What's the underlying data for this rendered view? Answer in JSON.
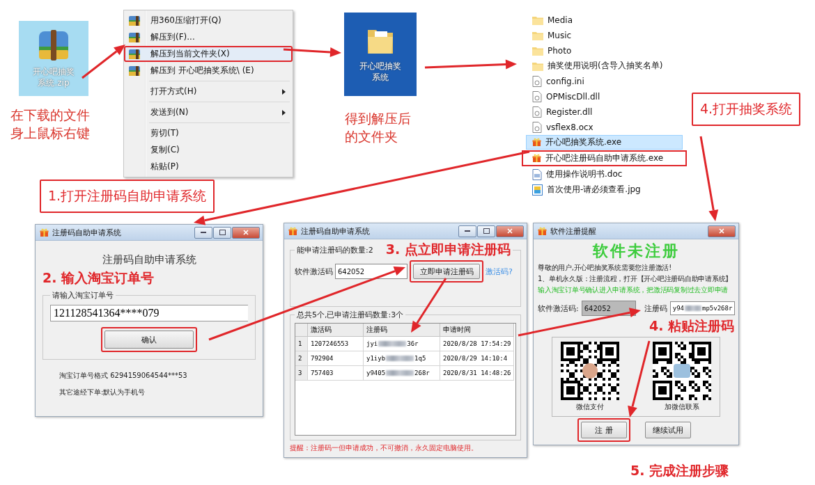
{
  "zip_file": {
    "label_lines": [
      "开心吧抽奖",
      "系统.zip"
    ]
  },
  "zip_caption": [
    "在下载的文件",
    "身上鼠标右键"
  ],
  "context_menu": {
    "items": [
      {
        "kind": "archive",
        "label": "用360压缩打开(Q)",
        "highlighted": false
      },
      {
        "kind": "archive",
        "label": "解压到(F)...",
        "highlighted": false
      },
      {
        "kind": "archive",
        "label": "解压到当前文件夹(X)",
        "highlighted": true
      },
      {
        "kind": "archive",
        "label": "解压到 开心吧抽奖系统\\ (E)",
        "highlighted": false
      },
      {
        "kind": "separator"
      },
      {
        "kind": "submenu",
        "label": "打开方式(H)",
        "highlighted": false
      },
      {
        "kind": "separator"
      },
      {
        "kind": "submenu",
        "label": "发送到(N)",
        "highlighted": false
      },
      {
        "kind": "separator"
      },
      {
        "kind": "plain",
        "label": "剪切(T)",
        "highlighted": false
      },
      {
        "kind": "plain",
        "label": "复制(C)",
        "highlighted": false
      },
      {
        "kind": "plain",
        "label": "粘贴(P)",
        "highlighted": false
      }
    ]
  },
  "folder": {
    "label_lines": [
      "开心吧抽奖",
      "系统"
    ]
  },
  "folder_caption": [
    "得到解压后",
    "的文件夹"
  ],
  "file_list": {
    "items": [
      {
        "kind": "folder",
        "name": "Media",
        "selected": false,
        "highlighted": false
      },
      {
        "kind": "folder",
        "name": "Music",
        "selected": false,
        "highlighted": false
      },
      {
        "kind": "folder",
        "name": "Photo",
        "selected": false,
        "highlighted": false
      },
      {
        "kind": "folder",
        "name": "抽奖使用说明(含导入抽奖名单)",
        "selected": false,
        "highlighted": false
      },
      {
        "kind": "file",
        "name": "config.ini",
        "selected": false,
        "highlighted": false
      },
      {
        "kind": "file",
        "name": "OPMiscDll.dll",
        "selected": false,
        "highlighted": false
      },
      {
        "kind": "file",
        "name": "Register.dll",
        "selected": false,
        "highlighted": false
      },
      {
        "kind": "file",
        "name": "vsflex8.ocx",
        "selected": false,
        "highlighted": false
      },
      {
        "kind": "exe",
        "name": "开心吧抽奖系统.exe",
        "selected": true,
        "highlighted": false
      },
      {
        "kind": "exe",
        "name": "开心吧注册码自助申请系统.exe",
        "selected": false,
        "highlighted": true
      },
      {
        "kind": "doc",
        "name": "使用操作说明书.doc",
        "selected": false,
        "highlighted": false
      },
      {
        "kind": "image",
        "name": "首次使用-请必须查看.jpg",
        "selected": false,
        "highlighted": false
      }
    ]
  },
  "callouts": [
    {
      "text": "4.打开抽奖系统"
    },
    {
      "text": "1.打开注册码自助申请系统"
    }
  ],
  "order_window": {
    "title": "注册码自助申请系统",
    "heading": "注册码自助申请系统",
    "step_label": "2. 输入淘宝订单号",
    "group_label": "请输入淘宝订单号",
    "order_value": "121128541364****079",
    "confirm_button": {
      "label": "确认",
      "highlighted": true
    },
    "notes": [
      "淘宝订单号格式 6294159064544***53",
      "其它途经下单:默认为手机号"
    ]
  },
  "apply_window": {
    "title": "注册码自助申请系统",
    "count_label": "能申请注册码的数量:2",
    "step_label": "3. 点立即申请注册码",
    "activation_label": "软件激活码",
    "activation_value": "642052",
    "apply_button": {
      "label": "立即申请注册码",
      "highlighted": true
    },
    "help_link": "激活码?",
    "list_label": "总共5个,已申请注册码数量:3个",
    "columns": [
      "激活码",
      "注册码",
      "申请时间"
    ],
    "rows": [
      {
        "number": "1",
        "activation": "1207246553",
        "code_start": "jyi",
        "code_end": "36r",
        "time": "2020/8/28 17:54:29"
      },
      {
        "number": "2",
        "activation": "792904",
        "code_start": "y1iyb",
        "code_end": "1q5",
        "time": "2020/8/29 14:10:4"
      },
      {
        "number": "3",
        "activation": "757403",
        "code_start": "y9405",
        "code_end": "268r",
        "time": "2020/8/31 14:48:26"
      }
    ],
    "warning": "提醒：注册码一但申请成功，不可撤消，永久固定电脑使用。"
  },
  "register_window": {
    "title": "软件注册提醒",
    "headline": "软件未注册",
    "lines": [
      {
        "kind": "normal",
        "text": "尊敬的用户,开心吧抽奖系统需要您注册激活!"
      },
      {
        "kind": "normal",
        "text": "1、单机永久版：注册流程，打开【开心吧注册码自助申请系统】"
      },
      {
        "kind": "hint",
        "text": "输入淘宝订单号确认进入申请系统，把激活码复制过去立即申请"
      }
    ],
    "activation_label": "软件激活码:",
    "activation_value": "642052",
    "code_label": "注册码",
    "code_start": "y94",
    "code_end": "mp5v268r",
    "step_label": "4. 粘贴注册码",
    "qr_codes": [
      {
        "caption": "微信支付"
      },
      {
        "caption": "加微信联系"
      }
    ],
    "buttons": [
      {
        "label": "注 册",
        "highlighted": true
      },
      {
        "label": "继续试用",
        "highlighted": false
      }
    ]
  },
  "final_step": "5. 完成注册步骤"
}
